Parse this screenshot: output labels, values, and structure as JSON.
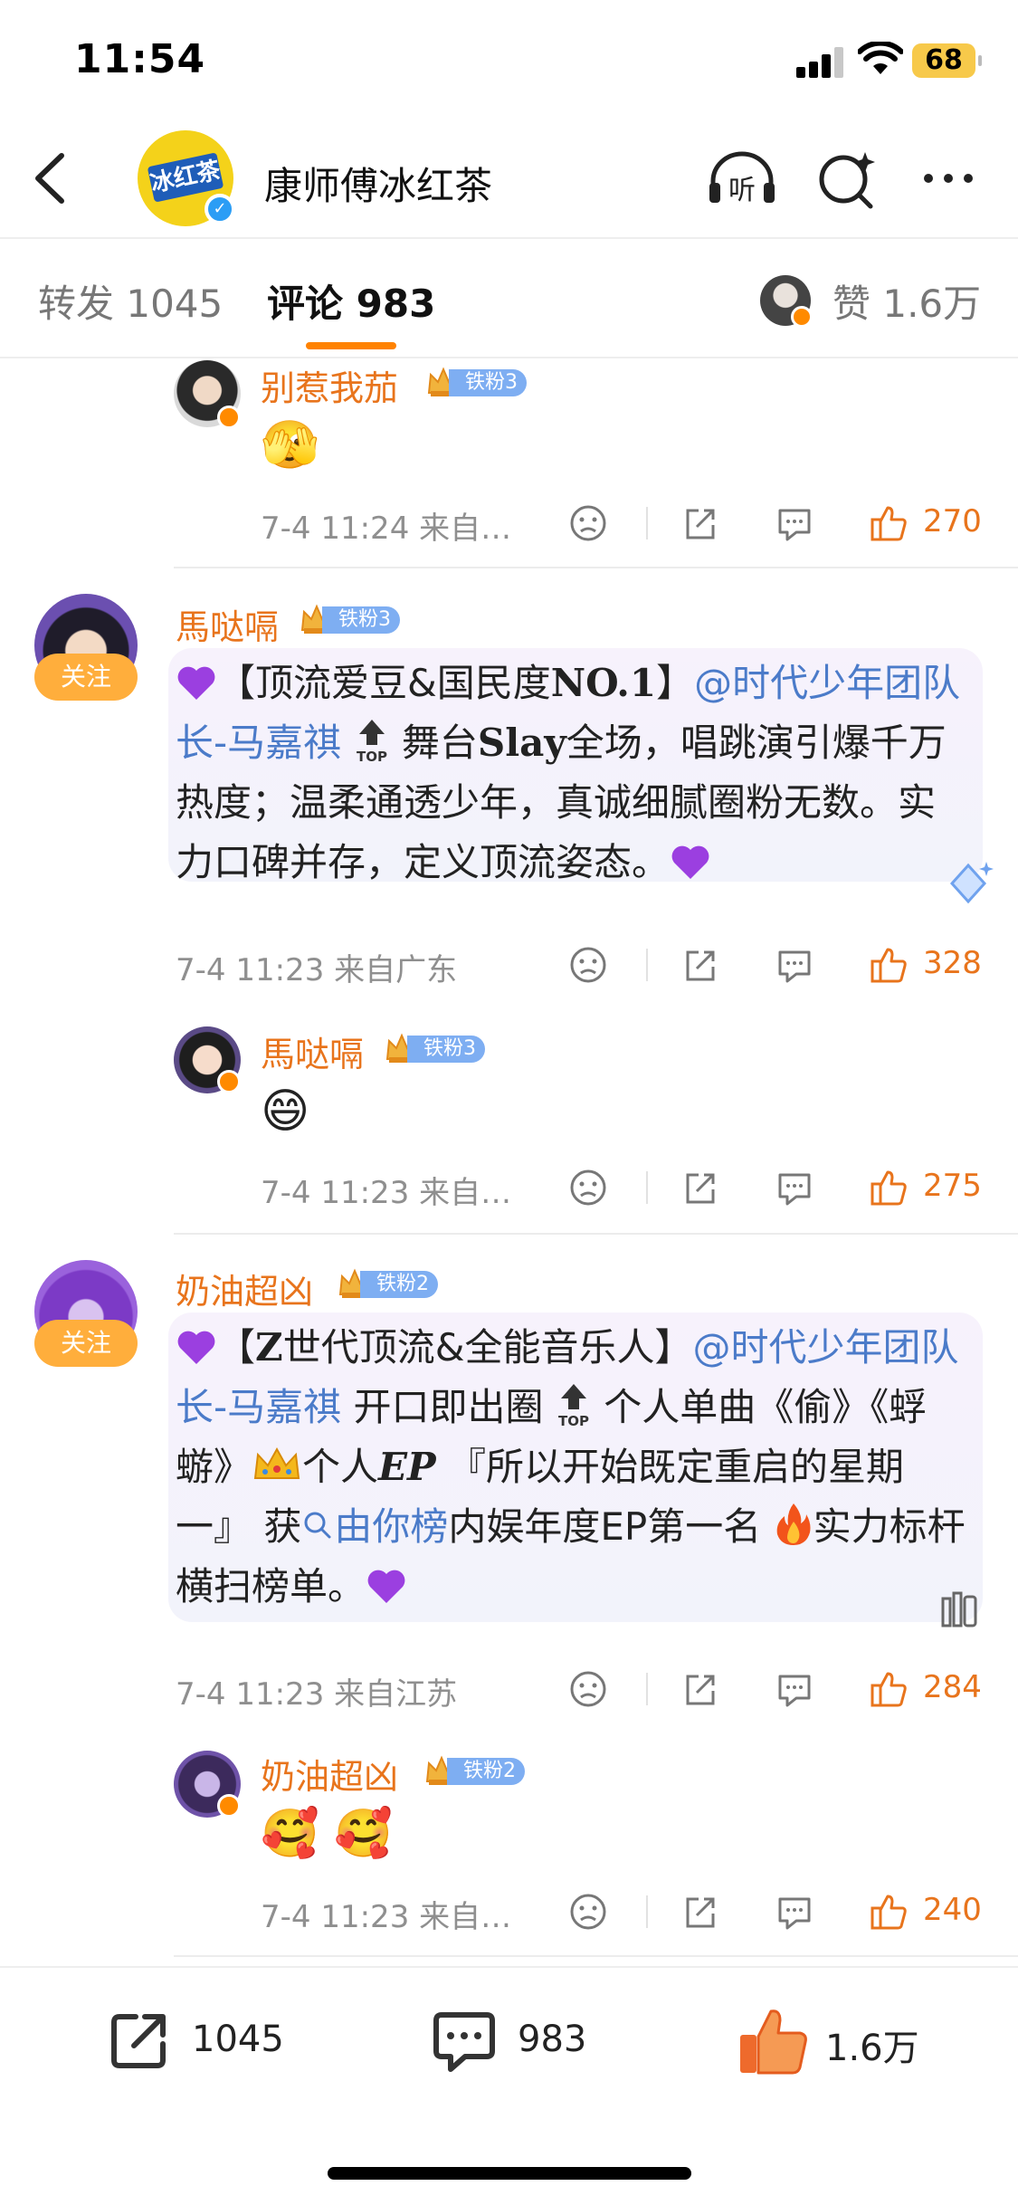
{
  "status": {
    "time": "11:54",
    "battery": "68"
  },
  "header": {
    "account_name": "康师傅冰红茶",
    "avatar_logo": "冰红茶"
  },
  "tabs": {
    "repost": "转发 1045",
    "comments": "评论 983",
    "likes": "赞 1.6万"
  },
  "comments": [
    {
      "user": "别惹我茄",
      "fan_level": "铁粉3",
      "content_emoji": "🫣",
      "meta": "7-4 11:24 来自…",
      "likes": "270",
      "reply": true
    },
    {
      "user": "馬哒嗝",
      "fan_level": "铁粉3",
      "follow": "关注",
      "text": {
        "p1": "【顶流爱豆&国民度",
        "p1b": "NO.1",
        "p1c": "】",
        "mention": "@时代少年团队长-马嘉祺",
        "p2": "舞台",
        "p2b": "Slay",
        "p3": "全场，唱跳演引爆千万热度；温柔通透少年，真诚细腻圈粉无数。实力口碑并存，定义顶流姿态。"
      },
      "meta": "7-4 11:23 来自广东",
      "likes": "328"
    },
    {
      "user": "馬哒嗝",
      "fan_level": "铁粉3",
      "content_emoji": "😄",
      "meta": "7-4 11:23 来自…",
      "likes": "275",
      "reply": true
    },
    {
      "user": "奶油超凶",
      "fan_level": "铁粉2",
      "follow": "关注",
      "text": {
        "p1": "【",
        "p1b": "Z",
        "p1c": "世代顶流&全能音乐人】",
        "mention": "@时代少年团队长-马嘉祺",
        "p2": "开口即出圈",
        "p3": "个人单曲《偷》《蜉蝣》",
        "p4": "个人",
        "p4b": "EP",
        "p5": "『所以开始既定重启的星期一』 获",
        "search": "由你榜",
        "p6": "内娱年度EP第一名",
        "p7": "实力标杆 横扫榜单。"
      },
      "meta": "7-4 11:23 来自江苏",
      "likes": "284"
    },
    {
      "user": "奶油超凶",
      "fan_level": "铁粉2",
      "content_emoji": "🥰 🥰",
      "meta": "7-4 11:23 来自…",
      "likes": "240",
      "reply": true
    }
  ],
  "bottom_bar": {
    "repost": "1045",
    "comment": "983",
    "like": "1.6万"
  },
  "colors": {
    "accent": "#ff8200",
    "username": "#e8741c",
    "mention": "#4b7bc9",
    "fan_pill": "#7eaef2"
  }
}
